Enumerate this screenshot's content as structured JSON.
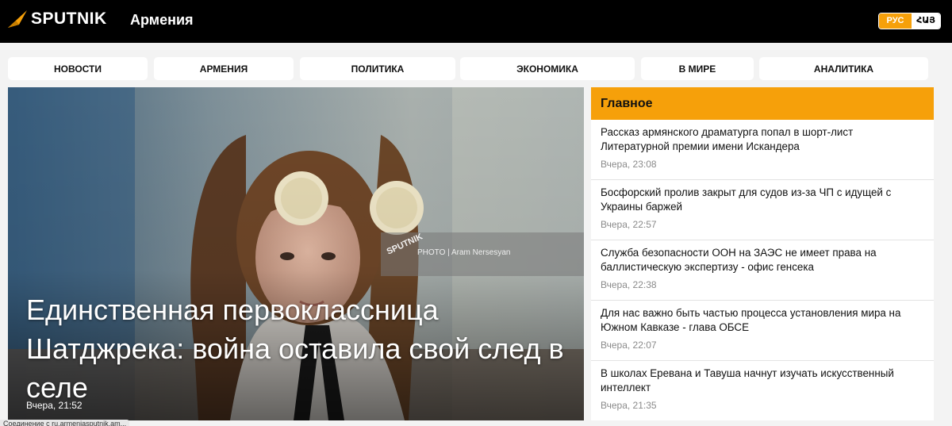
{
  "header": {
    "logo_text": "SPUTNIK",
    "region": "Армения",
    "lang_ru": "РУС",
    "lang_hy": "ՀԱՅ"
  },
  "nav": {
    "items": [
      "НОВОСТИ",
      "АРМЕНИЯ",
      "ПОЛИТИКА",
      "ЭКОНОМИКА",
      "В МИРЕ",
      "АНАЛИТИКА"
    ]
  },
  "hero": {
    "title": "Единственная первоклассница Шатджрека: война оставила свой след в селе",
    "time": "Вчера, 21:52",
    "photo_logo": "SPUTNIK",
    "photo_credit": "PHOTO | Aram Nersesyan"
  },
  "sidebar": {
    "heading": "Главное",
    "items": [
      {
        "title": "Рассказ армянского драматурга попал в шорт-лист Литературной премии имени Искандера",
        "time": "Вчера, 23:08"
      },
      {
        "title": "Босфорский пролив закрыт для судов из-за ЧП с идущей с Украины баржей",
        "time": "Вчера, 22:57"
      },
      {
        "title": "Служба безопасности ООН на ЗАЭС не имеет права на баллистическую экспертизу - офис генсека",
        "time": "Вчера, 22:38"
      },
      {
        "title": "Для нас важно быть частью процесса установления мира на Южном Кавказе - глава ОБСЕ",
        "time": "Вчера, 22:07"
      },
      {
        "title": "В школах Еревана и Тавуша начнут изучать искусственный интеллект",
        "time": "Вчера, 21:35"
      }
    ]
  },
  "status_bar": "Соединение с ru.armeniasputnik.am...",
  "colors": {
    "accent": "#f6a00a",
    "header_bg": "#000000",
    "page_bg": "#f3f3f3"
  }
}
